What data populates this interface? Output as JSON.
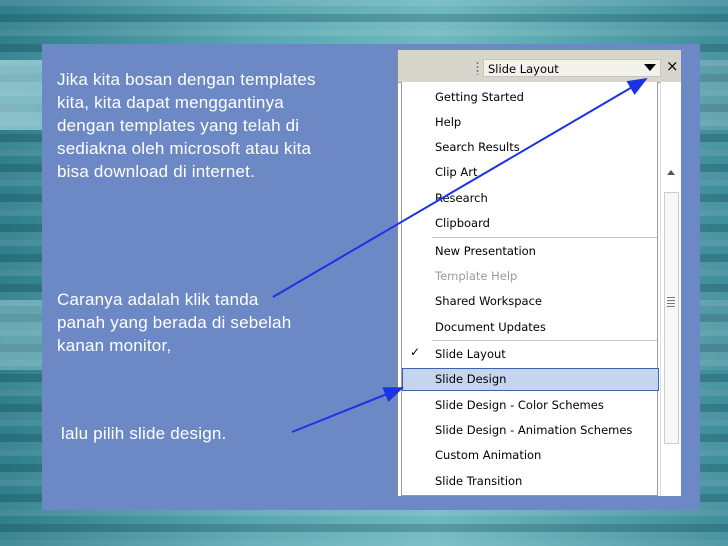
{
  "slide": {
    "paragraph1": "Jika kita bosan dengan templates kita, kita dapat menggantinya dengan templates yang telah di sediakna oleh microsoft atau kita bisa download di internet.",
    "paragraph2": "Caranya adalah klik tanda panah yang berada di sebelah kanan monitor,",
    "paragraph3": "lalu pilih slide design."
  },
  "task_pane": {
    "dropdown_label": "Slide Layout",
    "close_glyph": "×",
    "menu_items": [
      {
        "label": "Getting Started"
      },
      {
        "label": "Help"
      },
      {
        "label": "Search Results"
      },
      {
        "label": "Clip Art"
      },
      {
        "label": "Research"
      },
      {
        "label": "Clipboard"
      },
      {
        "label": "New Presentation"
      },
      {
        "label": "Template Help"
      },
      {
        "label": "Shared Workspace"
      },
      {
        "label": "Document Updates"
      },
      {
        "label": "Slide Layout"
      },
      {
        "label": "Slide Design"
      },
      {
        "label": "Slide Design - Color Schemes"
      },
      {
        "label": "Slide Design - Animation Schemes"
      },
      {
        "label": "Custom Animation"
      },
      {
        "label": "Slide Transition"
      }
    ],
    "checked_item": "Slide Layout",
    "highlighted_item": "Slide Design",
    "disabled_item": "Template Help",
    "check_glyph": "✓"
  },
  "colors": {
    "panel": "#6d89c5",
    "annotation_line": "#1b33e6",
    "highlight": "#c5d5ee"
  }
}
